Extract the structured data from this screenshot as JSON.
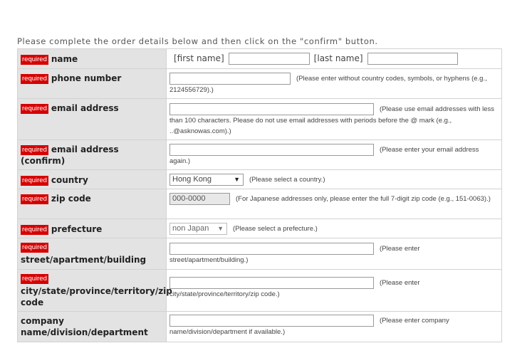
{
  "intro": "Please complete the order details below and then click on the \"confirm\" button.",
  "required_label": "required",
  "rows": {
    "name": {
      "label": "name",
      "first_label": "[first name]",
      "last_label": "[last name]",
      "first_value": "",
      "last_value": ""
    },
    "phone": {
      "label": "phone number",
      "value": "",
      "help": "(Please enter without country codes, symbols, or hyphens (e.g., 2124556729).)"
    },
    "email": {
      "label": "email address",
      "value": "",
      "help": "(Please use email addresses with less than 100 characters. Please do not use email addresses with periods before the @ mark (e.g., ..@asknowas.com).)"
    },
    "email_confirm": {
      "label": "email address (confirm)",
      "value": "",
      "help": "(Please enter your email address again.)"
    },
    "country": {
      "label": "country",
      "selected": "Hong Kong",
      "help": "(Please select a country.)"
    },
    "zip": {
      "label": "zip code",
      "value": "000-0000",
      "help": "(For Japanese addresses only, please enter the full 7-digit zip code (e.g., 151-0063).)"
    },
    "prefecture": {
      "label": "prefecture",
      "selected": "non Japan",
      "help": "(Please select a prefecture.)"
    },
    "street": {
      "label": "street/apartment/building",
      "value": "",
      "help_a": "(Please enter",
      "help_b": "street/apartment/building.)"
    },
    "city": {
      "label": "city/state/province/territory/zip code",
      "value": "",
      "help_a": "(Please enter",
      "help_b": "city/state/province/territory/zip code.)"
    },
    "company": {
      "label": "company name/division/department",
      "value": "",
      "help_a": "(Please enter company",
      "help_b": "name/division/department if available.)"
    }
  }
}
